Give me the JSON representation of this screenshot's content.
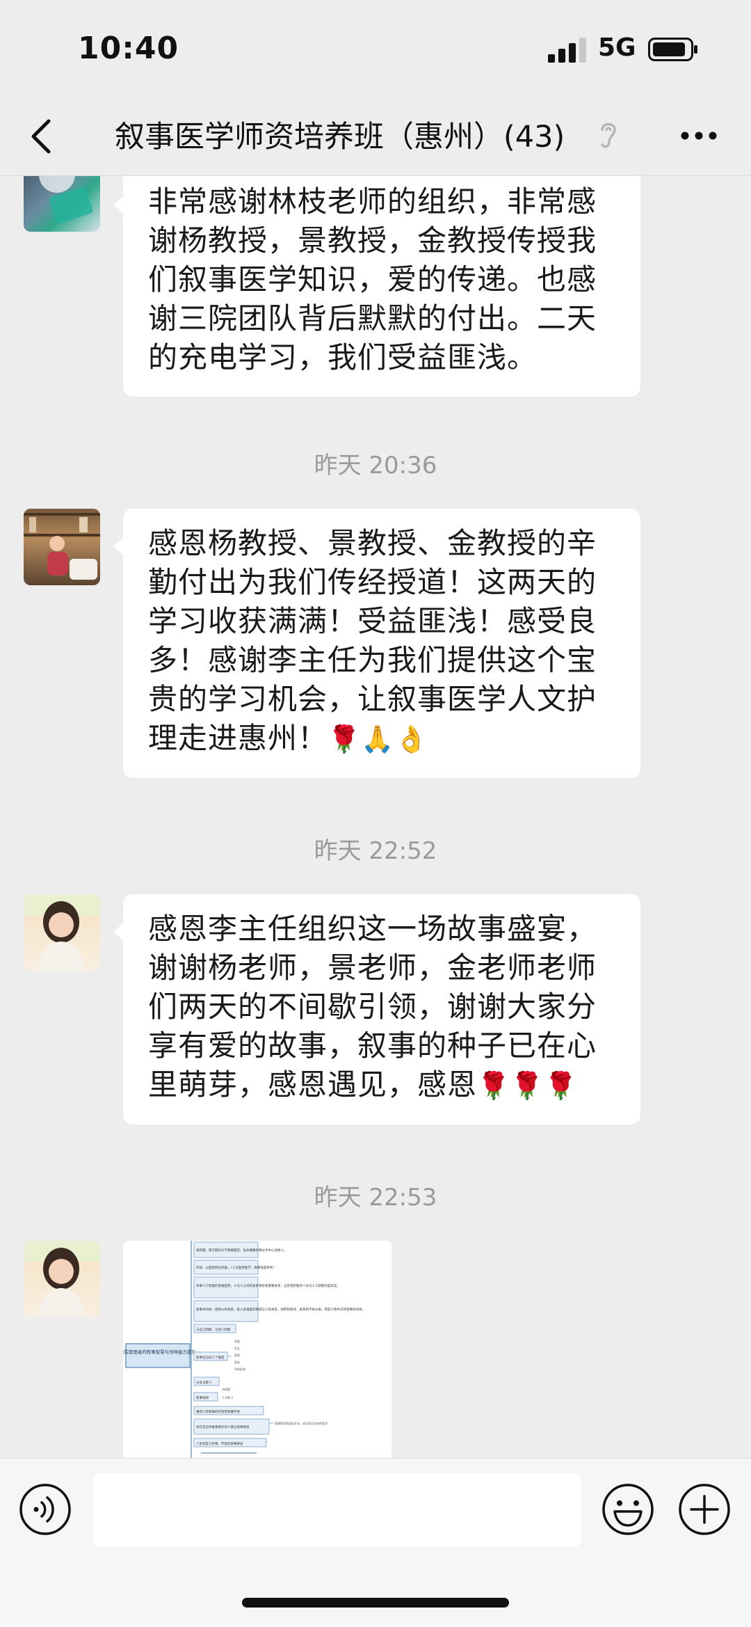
{
  "status_bar": {
    "time": "10:40",
    "network": "5G"
  },
  "header": {
    "title": "叙事医学师资培养班（惠州）(43)"
  },
  "messages": [
    {
      "text": "非常感谢林枝老师的组织，非常感谢杨教授，景教授，金教授传授我们叙事医学知识，爱的传递。也感谢三院团队背后默默的付出。二天的充电学习，我们受益匪浅。"
    },
    {
      "time": "昨天 20:36",
      "text": "感恩杨教授、景教授、金教授的辛勤付出为我们传经授道！这两天的学习收获满满！受益匪浅！感受良多！感谢李主任为我们提供这个宝贵的学习机会，让叙事医学人文护理走进惠州！",
      "emojis": "🌹🙏👌"
    },
    {
      "time": "昨天 22:52",
      "text": "感恩李主任组织这一场故事盛宴，谢谢杨老师，景老师，金老师老师们两天的不间歇引领，谢谢大家分享有爱的故事，叙事的种子已在心里萌芽，感恩遇见，感恩",
      "emojis": "🌹🌹🌹"
    },
    {
      "time": "昨天 22:53"
    }
  ],
  "mindmap": {
    "root": "医院管理者的叙事智慧与领导能力提升",
    "nodes": [
      "组织篇：南方医科大学顺德医院，生命健康叙事分享中心创始人。",
      "开场：以医院院训开篇，（人文医养医学、叙事温度养育）",
      "未来人工智能的发展趋势，人与人之间的关系将愈发重要关系，立足组织服务人员与人工智能的差异化。",
      "叙事共同体：提供公共关系、投入多维度的情感与人际关系，组织和叙述、关系和不再分离，而是人性共识的叙事共同体。",
      "与自己和解、与他人和解",
      "叙事生态的几个维度",
      "分支主题 5",
      "叙事调研",
      "懂得人际叙事的开放性和循环性",
      "住在走出中素重要任何人建立叙事链接",
      "人生就是几件我、伴侣的叙事讲述"
    ],
    "sub_nodes": [
      "家庭",
      "社区",
      "医院",
      "医务",
      "学校延伸",
      "讲述图",
      "千分数 3"
    ],
    "side_note": "叙事性医院组织文化，成为身边生态的医学"
  }
}
